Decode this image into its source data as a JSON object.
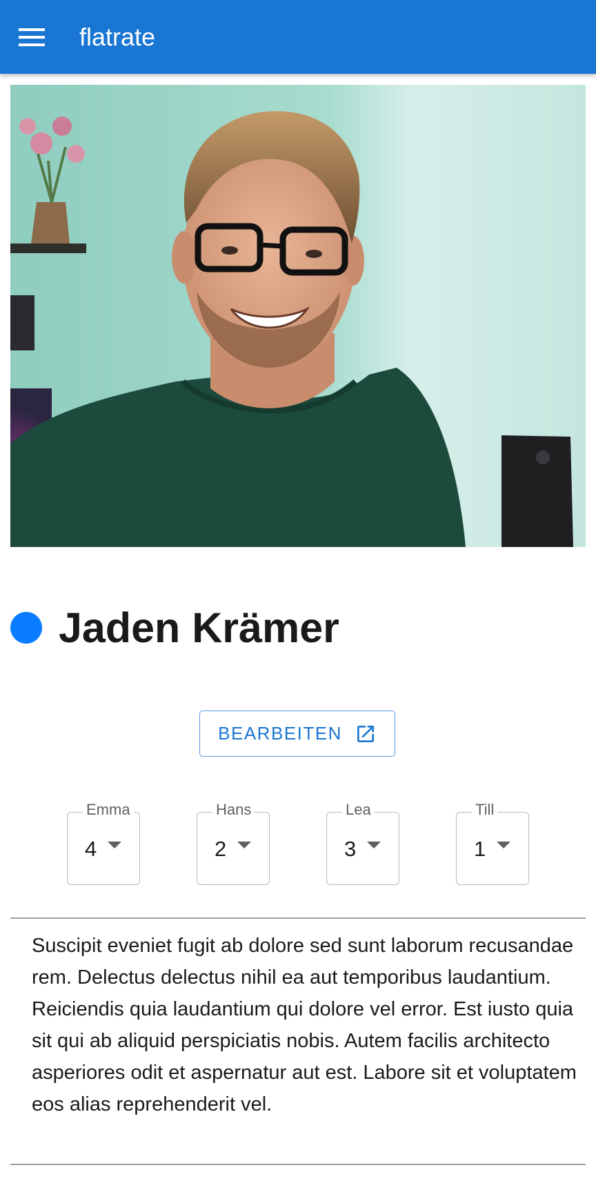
{
  "app_bar": {
    "title": "flatrate",
    "menu_icon": "hamburger-menu-icon",
    "background_color": "#1976d2"
  },
  "profile": {
    "photo": "portrait-photo",
    "status_color": "#0a7cff",
    "name": "Jaden Krämer",
    "edit_label": "BEARBEITEN",
    "edit_icon": "open-in-new-icon",
    "ratings": [
      {
        "label": "Emma",
        "value": "4"
      },
      {
        "label": "Hans",
        "value": "2"
      },
      {
        "label": "Lea",
        "value": "3"
      },
      {
        "label": "Till",
        "value": "1"
      }
    ],
    "description": "Suscipit eveniet fugit ab dolore sed sunt laborum recusandae rem. Delectus delectus nihil ea aut temporibus laudantium. Reiciendis quia laudantium qui dolore vel error. Est iusto quia sit qui ab aliquid perspiciatis nobis. Autem facilis architecto asperiores odit et aspernatur aut est. Labore sit et voluptatem eos alias reprehenderit vel."
  }
}
